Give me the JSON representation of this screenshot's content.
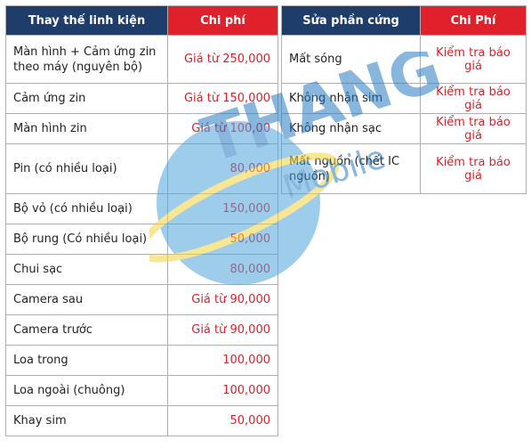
{
  "left_table": {
    "headers": [
      "Thay thế linh kiện",
      "Chi phí"
    ],
    "rows": [
      {
        "item": "Màn hình + Cảm ứng zin theo máy (nguyên bộ)",
        "price": "Giá từ 250,000"
      },
      {
        "item": "Cảm ứng zin",
        "price": "Giá từ 150,000"
      },
      {
        "item": "Màn hình zin",
        "price": "Giá từ 100,00"
      },
      {
        "item": "Pin (có nhiều loại)",
        "price": "80,000"
      },
      {
        "item": "Bộ vỏ (có nhiều loại)",
        "price": "150,000"
      },
      {
        "item": "Bộ rung (Có nhiều loại)",
        "price": "50,000"
      },
      {
        "item": "Chui sạc",
        "price": "80,000"
      },
      {
        "item": "Camera sau",
        "price": "Giá từ 90,000"
      },
      {
        "item": "Camera trước",
        "price": "Giá từ 90,000"
      },
      {
        "item": "Loa trong",
        "price": "100,000"
      },
      {
        "item": "Loa ngoài (chuông)",
        "price": "100,000"
      },
      {
        "item": "Khay sim",
        "price": "50,000"
      }
    ]
  },
  "right_table": {
    "headers": [
      "Sửa phần cứng",
      "Chi Phí"
    ],
    "rows": [
      {
        "item": "Mất sóng",
        "price": "Kiểm tra báo giá"
      },
      {
        "item": "Không nhận sim",
        "price": "Kiểm tra báo giá"
      },
      {
        "item": "Không nhận sạc",
        "price": "Kiểm tra báo giá"
      },
      {
        "item": "Mất nguồn (chết IC nguồn)",
        "price": "Kiểm tra báo giá"
      }
    ]
  },
  "watermark": {
    "text_main": "THANG",
    "text_sub": "Mobile"
  },
  "colors": {
    "header_navy": "#1f3d6b",
    "header_red": "#e0202a",
    "price_red": "#e0202a"
  }
}
